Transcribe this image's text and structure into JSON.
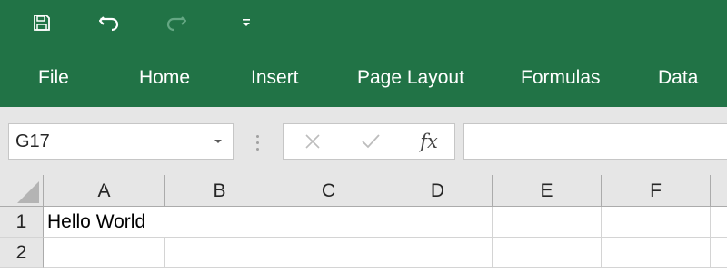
{
  "quick_access": {
    "save_icon": "save-icon",
    "undo_icon": "undo-icon",
    "redo_icon": "redo-icon",
    "customize_icon": "dropdown-arrow-icon"
  },
  "ribbon": {
    "tabs": [
      {
        "label": "File"
      },
      {
        "label": "Home"
      },
      {
        "label": "Insert"
      },
      {
        "label": "Page Layout"
      },
      {
        "label": "Formulas"
      },
      {
        "label": "Data"
      }
    ]
  },
  "formula_bar": {
    "name_box": "G17",
    "fx_label": "fx",
    "formula_value": ""
  },
  "grid": {
    "columns": [
      "A",
      "B",
      "C",
      "D",
      "E",
      "F"
    ],
    "rows": [
      "1",
      "2"
    ],
    "cells": {
      "A1": "Hello World"
    }
  },
  "colors": {
    "ribbon": "#217346",
    "header_bg": "#e6e6e6",
    "gridline": "#d4d4d4"
  }
}
